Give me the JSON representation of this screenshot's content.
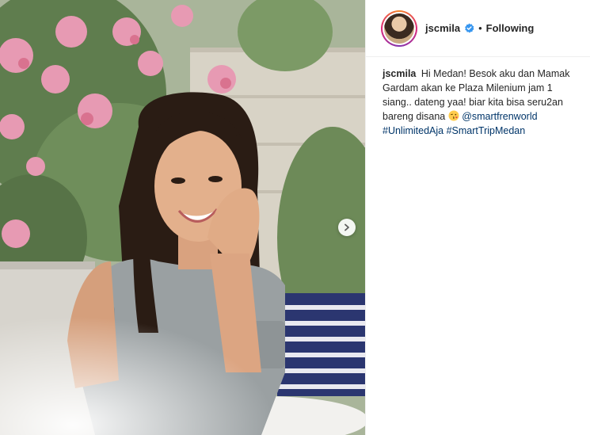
{
  "header": {
    "username": "jscmila",
    "separator": "•",
    "follow_label": "Following"
  },
  "caption": {
    "username": "jscmila",
    "text_part1": "Hi Medan! Besok aku dan Mamak Gardam akan ke Plaza Milenium jam 1 siang.. dateng yaa! biar kita bisa seru2an bareng disana",
    "mention": "@smartfrenworld",
    "hashtag1": "#UnlimitedAja",
    "hashtag2": "#SmartTripMedan"
  },
  "icons": {
    "verified": "verified-badge-icon",
    "next": "chevron-right-icon",
    "emoji": "kissing-face-emoji"
  },
  "colors": {
    "verified_blue": "#3897f0",
    "link_blue": "#003569",
    "text": "#262626",
    "border": "#efefef"
  }
}
